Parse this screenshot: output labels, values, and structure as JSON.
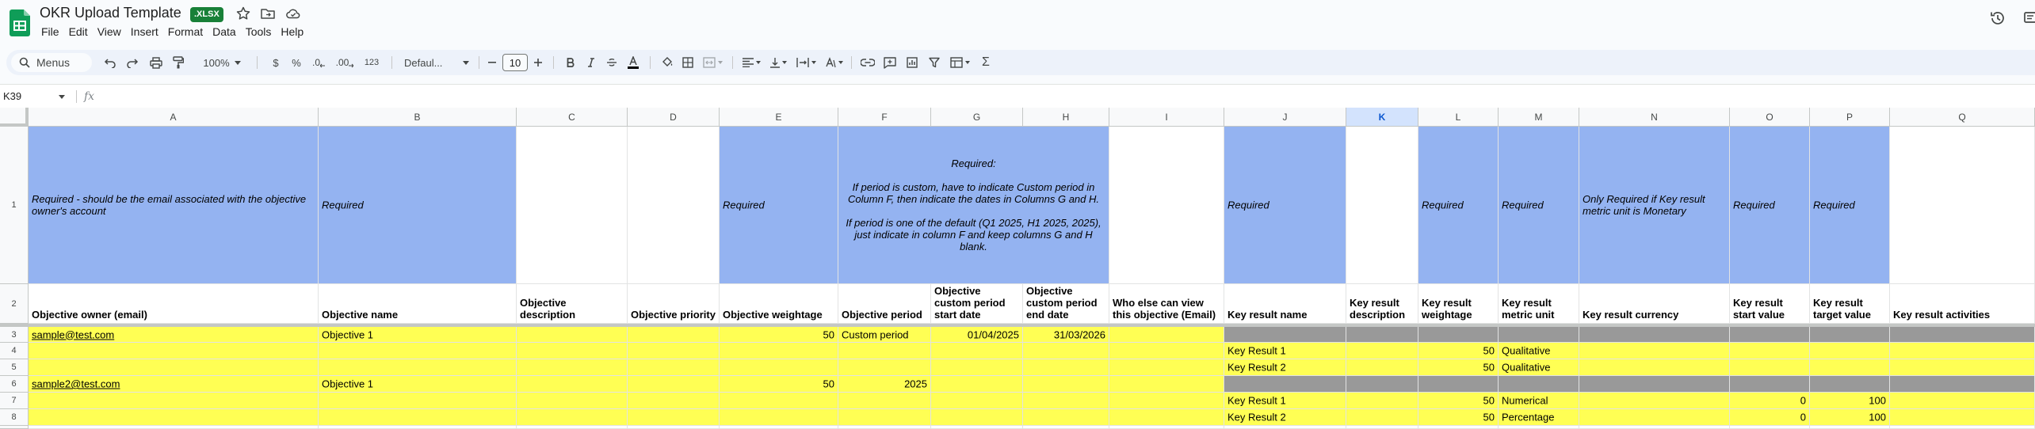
{
  "title_bar": {
    "document_title": "OKR Upload Template",
    "file_badge": ".XLSX",
    "icons": [
      "star-icon",
      "move-folder-icon",
      "cloud-status-icon",
      "version-history-icon",
      "comments-icon"
    ],
    "brand_color": "#0f9d58"
  },
  "menu": {
    "items": [
      "File",
      "Edit",
      "View",
      "Insert",
      "Format",
      "Data",
      "Tools",
      "Help"
    ]
  },
  "toolbar": {
    "search_placeholder": "Menus",
    "zoom": "100%",
    "currency": "$",
    "percent": "%",
    "decrease_decimal": ".0",
    "increase_decimal": ".00",
    "number_format": "123",
    "font_family": "Defaul...",
    "font_size": "10",
    "functions": "Σ"
  },
  "formula_bar": {
    "name_box": "K39",
    "fx": "fx",
    "formula": ""
  },
  "columns": [
    "A",
    "B",
    "C",
    "D",
    "E",
    "F",
    "G",
    "H",
    "I",
    "J",
    "K",
    "L",
    "M",
    "N",
    "O",
    "P",
    "Q"
  ],
  "rows": [
    "1",
    "2",
    "3",
    "4",
    "5",
    "6",
    "7",
    "8"
  ],
  "row1": {
    "A": "Required - should be the email associated with the objective owner's account",
    "B": "Required",
    "E": "Required",
    "FGH": "Required:\n\nIf period is custom, have to indicate Custom period in Column F, then indicate the dates in Columns G and H.\n\nIf period is one of the default (Q1 2025, H1 2025, 2025), just indicate in column F and keep columns G and H blank.",
    "J": "Required",
    "L": "Required",
    "M": "Required",
    "N": "Only Required if Key result metric unit is Monetary",
    "O": "Required",
    "P": "Required"
  },
  "headers": {
    "A": "Objective owner (email)",
    "B": "Objective name",
    "C": "Objective description",
    "D": "Objective priority",
    "E": "Objective weightage",
    "F": "Objective period",
    "G": "Objective custom period start date",
    "H": "Objective custom period end date",
    "I": "Who else can view this objective (Email)",
    "J": "Key result name",
    "K": "Key result description",
    "L": "Key result weightage",
    "M": "Key result metric unit",
    "N": "Key result currency",
    "O": "Key result start value",
    "P": "Key result target value",
    "Q": "Key result activities"
  },
  "data_rows": {
    "r3": {
      "A": "sample@test.com",
      "B": "Objective 1",
      "E": "50",
      "F": "Custom period",
      "G": "01/04/2025",
      "H": "31/03/2026"
    },
    "r4": {
      "J": "Key Result 1",
      "L": "50",
      "M": "Qualitative"
    },
    "r5": {
      "J": "Key Result 2",
      "L": "50",
      "M": "Qualitative"
    },
    "r6": {
      "A": "sample2@test.com",
      "B": "Objective 1",
      "E": "50",
      "F": "2025"
    },
    "r7": {
      "J": "Key Result 1",
      "L": "50",
      "M": "Numerical",
      "O": "0",
      "P": "100"
    },
    "r8": {
      "J": "Key Result 2",
      "L": "50",
      "M": "Percentage",
      "O": "0",
      "P": "100"
    }
  },
  "colors": {
    "required_blue": "#94b3f1",
    "sample_yellow": "#ffff54",
    "separator_gray": "#999999",
    "selected_column": "#d3e3fd"
  }
}
